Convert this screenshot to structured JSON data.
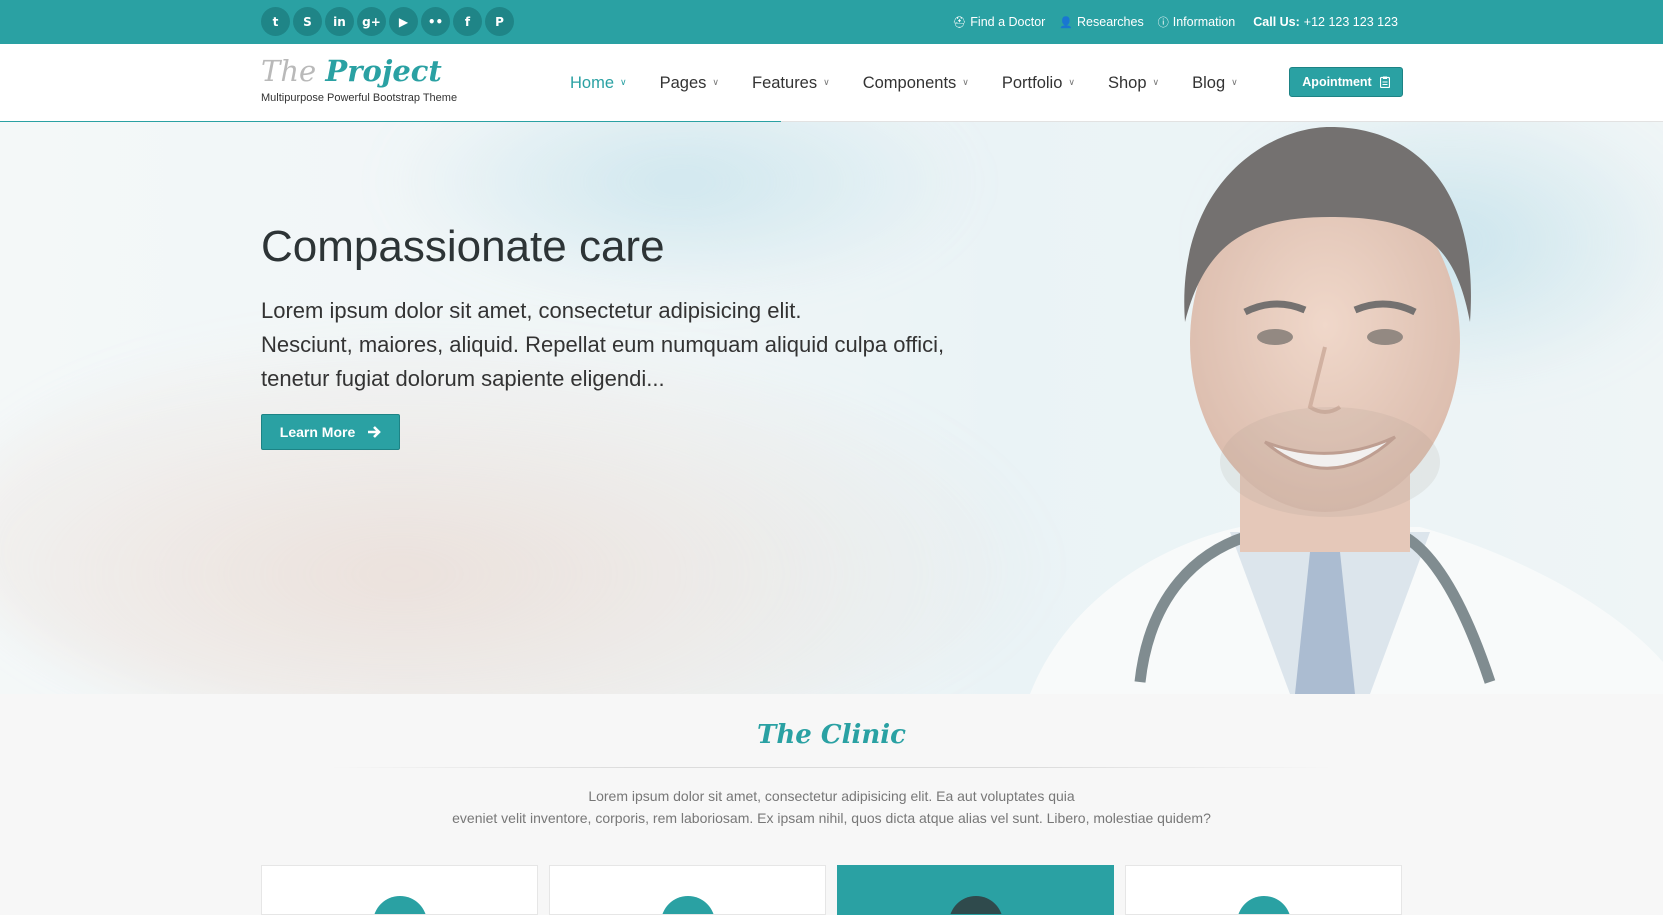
{
  "topbar": {
    "socials": [
      {
        "name": "twitter-icon",
        "glyph": "t"
      },
      {
        "name": "skype-icon",
        "glyph": "S"
      },
      {
        "name": "linkedin-icon",
        "glyph": "in"
      },
      {
        "name": "googleplus-icon",
        "glyph": "g+"
      },
      {
        "name": "youtube-icon",
        "glyph": "▶"
      },
      {
        "name": "flickr-icon",
        "glyph": "••"
      },
      {
        "name": "facebook-icon",
        "glyph": "f"
      },
      {
        "name": "pinterest-icon",
        "glyph": "P"
      }
    ],
    "links": {
      "find_doctor": "Find a Doctor",
      "researches": "Researches",
      "information": "Information"
    },
    "call_label": "Call Us:",
    "call_number": "+12 123 123 123"
  },
  "header": {
    "logo_the": "The",
    "logo_project": "Project",
    "tagline": "Multipurpose Powerful Bootstrap Theme",
    "nav": {
      "home": "Home",
      "pages": "Pages",
      "features": "Features",
      "components": "Components",
      "portfolio": "Portfolio",
      "shop": "Shop",
      "blog": "Blog"
    },
    "appointment_label": "Apointment"
  },
  "hero": {
    "title": "Compassionate care",
    "text_line1": "Lorem ipsum dolor sit amet, consectetur adipisicing elit.",
    "text_line2": "Nesciunt, maiores, aliquid. Repellat eum numquam aliquid culpa offici,",
    "text_line3": "tenetur fugiat dolorum sapiente eligendi...",
    "button_label": "Learn More"
  },
  "clinic": {
    "title": "The Clinic",
    "text_line1": "Lorem ipsum dolor sit amet, consectetur adipisicing elit. Ea aut voluptates quia",
    "text_line2": "eveniet velit inventore, corporis, rem laboriosam. Ex ipsam nihil, quos dicta atque alias vel sunt. Libero, molestiae quidem?"
  },
  "colors": {
    "accent": "#2aa1a3",
    "accent_dark": "#1f8587",
    "text_dark": "#333333"
  }
}
